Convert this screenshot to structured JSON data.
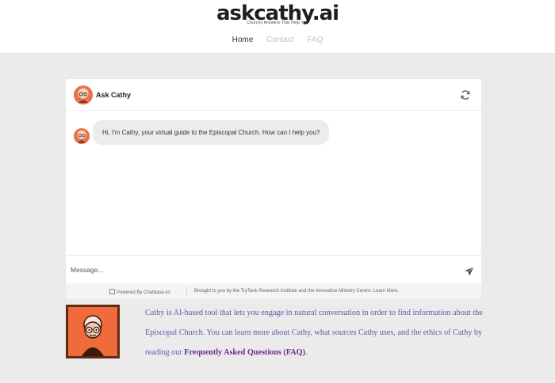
{
  "brand": {
    "logo_text": "askcathy.ai",
    "tagline": "Churchy Answers That Help You"
  },
  "nav": {
    "items": [
      "Home",
      "Contact",
      "FAQ"
    ],
    "active": "Home"
  },
  "chat": {
    "title": "Ask Cathy",
    "refresh_icon": "refresh-icon",
    "messages": [
      {
        "role": "bot",
        "text": "Hi, I'm Cathy, your virtual guide to the Episcopal Church. How can I help you?"
      }
    ],
    "input_placeholder": "Message...",
    "send_icon": "send-icon",
    "footer": {
      "powered": "Powered By Chatbase.co",
      "brought": "Brought to you by the TryTank Research Institute and the Innovative Ministry Centre. Learn More."
    }
  },
  "about": {
    "text_before_link": "Cathy is AI-based tool that lets you engage in natural conversation in order to find information about the Episcopal Church. You can learn more about Cathy, what sources Cathy uses, and the ethics of Cathy by reading our ",
    "link_text": "Frequently Asked Questions (FAQ)",
    "text_after_link": "."
  },
  "colors": {
    "accent_orange": "#f06b3c",
    "link_purple": "#6a2a8c",
    "text_purple": "#6a52a8"
  }
}
